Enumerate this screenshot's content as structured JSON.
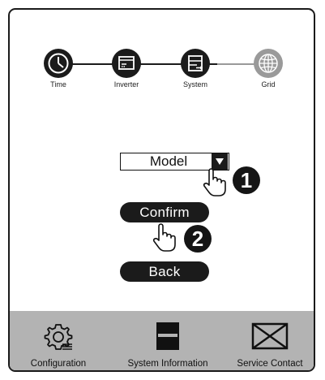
{
  "steps": [
    {
      "label": "Time",
      "icon": "clock-icon",
      "state": "active"
    },
    {
      "label": "Inverter",
      "icon": "inverter-icon",
      "state": "active"
    },
    {
      "label": "System",
      "icon": "system-icon",
      "state": "active"
    },
    {
      "label": "Grid",
      "icon": "globe-icon",
      "state": "inactive"
    }
  ],
  "model_select": {
    "value": "Model"
  },
  "buttons": {
    "confirm": "Confirm",
    "back": "Back"
  },
  "step_badges": {
    "one": "1",
    "two": "2"
  },
  "bottom_nav": [
    {
      "label": "Configuration",
      "icon": "gear-icon"
    },
    {
      "label": "System Information",
      "icon": "system-info-icon"
    },
    {
      "label": "Service Contact",
      "icon": "envelope-icon"
    }
  ],
  "colors": {
    "dark": "#1b1b1b",
    "inactive": "#9a9a9a",
    "bar": "#b3b3b3"
  }
}
